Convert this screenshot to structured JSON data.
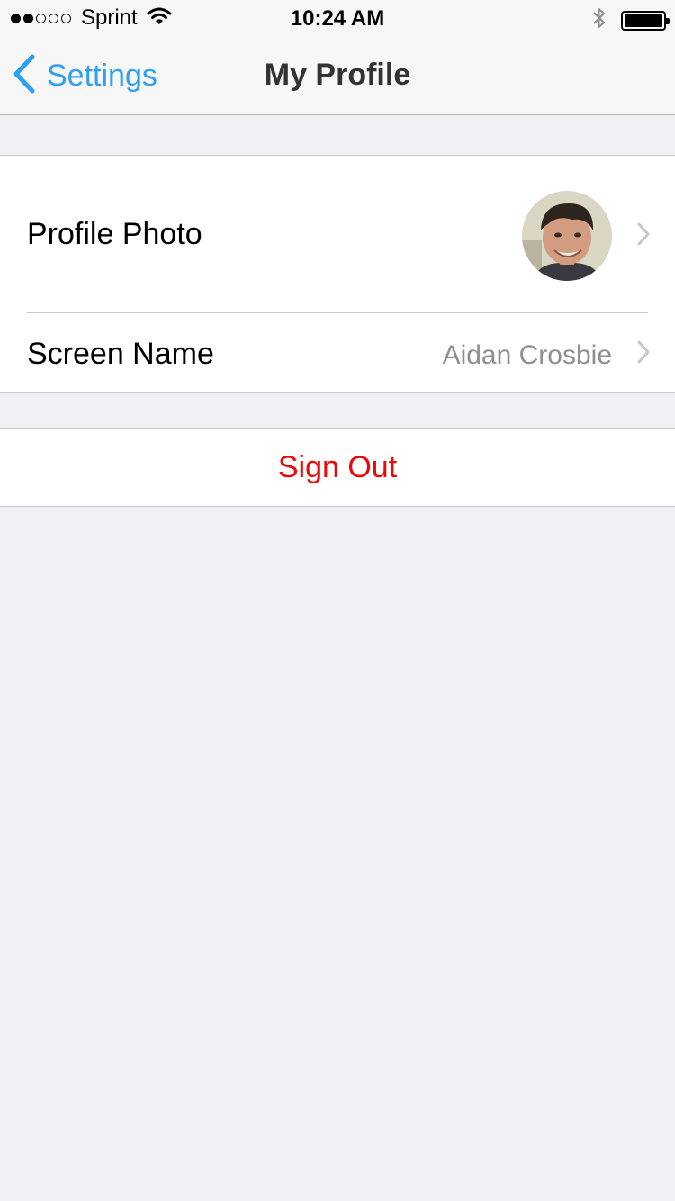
{
  "status_bar": {
    "signal_dots_filled": 2,
    "signal_dots_total": 5,
    "carrier": "Sprint",
    "time": "10:24 AM",
    "icons": [
      "wifi-icon",
      "bluetooth-icon",
      "battery-icon"
    ],
    "battery_level": 1.0
  },
  "nav": {
    "back_label": "Settings",
    "title": "My Profile"
  },
  "profile": {
    "photo_label": "Profile Photo",
    "screen_name_label": "Screen Name",
    "screen_name_value": "Aidan Crosbie"
  },
  "actions": {
    "sign_out_label": "Sign Out"
  },
  "colors": {
    "accent": "#2f9ff3",
    "destructive": "#ef0707",
    "background": "#efeff4",
    "secondary_text": "#8e8e93"
  }
}
